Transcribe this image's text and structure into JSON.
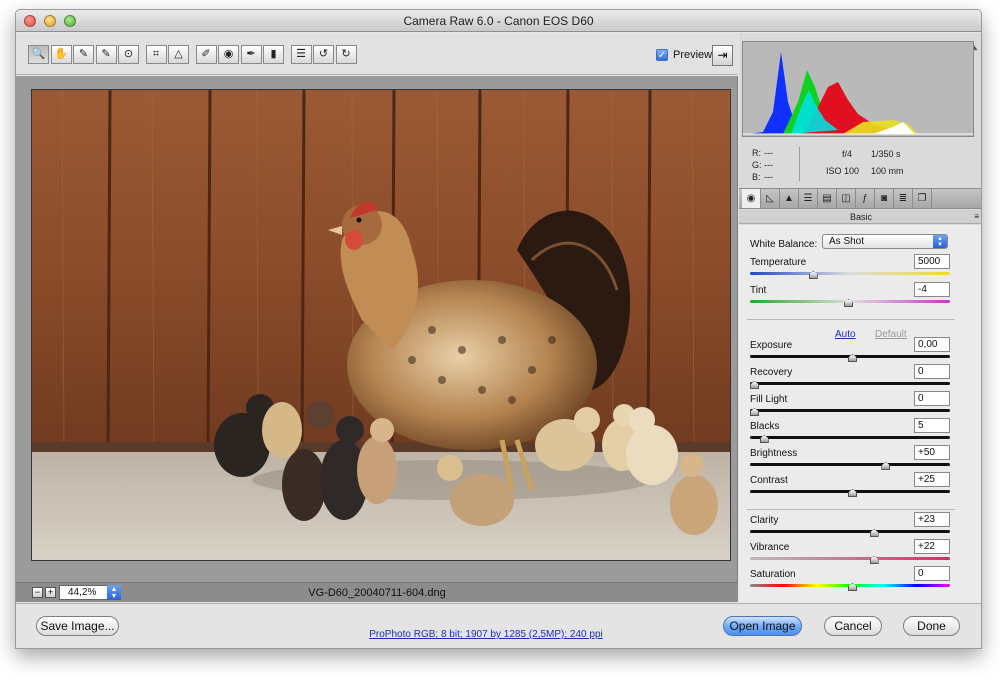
{
  "window": {
    "title": "Camera Raw 6.0  -  Canon EOS D60"
  },
  "toolbar": {
    "tools": [
      {
        "name": "zoom-tool-icon",
        "glyph": "🔍"
      },
      {
        "name": "hand-tool-icon",
        "glyph": "✋"
      },
      {
        "name": "white-balance-tool-icon",
        "glyph": "✎"
      },
      {
        "name": "color-sampler-tool-icon",
        "glyph": "✎"
      },
      {
        "name": "targeted-adjustment-tool-icon",
        "glyph": "⊙"
      },
      {
        "name": "crop-tool-icon",
        "glyph": "⌗"
      },
      {
        "name": "straighten-tool-icon",
        "glyph": "△"
      },
      {
        "name": "spot-removal-tool-icon",
        "glyph": "✐"
      },
      {
        "name": "red-eye-tool-icon",
        "glyph": "◉"
      },
      {
        "name": "adjustment-brush-icon",
        "glyph": "✒"
      },
      {
        "name": "graduated-filter-icon",
        "glyph": "▮"
      },
      {
        "name": "preferences-icon",
        "glyph": "☰"
      },
      {
        "name": "rotate-left-icon",
        "glyph": "↺"
      },
      {
        "name": "rotate-right-icon",
        "glyph": "↻"
      }
    ],
    "preview_label": "Preview"
  },
  "status": {
    "zoom": "44,2%",
    "filename": "VG-D60_20040711-604.dng"
  },
  "footer": {
    "save_label": "Save Image...",
    "workflow_link": "ProPhoto RGB; 8 bit; 1907 by 1285 (2,5MP); 240 ppi",
    "open_label": "Open Image",
    "cancel_label": "Cancel",
    "done_label": "Done"
  },
  "readout": {
    "r_label": "R:",
    "g_label": "G:",
    "b_label": "B:",
    "r": "---",
    "g": "---",
    "b": "---",
    "aperture": "f/4",
    "shutter": "1/350 s",
    "iso": "ISO 100",
    "focal": "100 mm"
  },
  "panel": {
    "title": "Basic",
    "wb_label": "White Balance:",
    "wb_value": "As Shot",
    "auto_label": "Auto",
    "default_label": "Default"
  },
  "sliders": [
    {
      "key": "temperature",
      "label": "Temperature",
      "value": "5000",
      "pos": 0.3
    },
    {
      "key": "tint",
      "label": "Tint",
      "value": "-4",
      "pos": 0.48
    },
    {
      "key": "exposure",
      "label": "Exposure",
      "value": "0,00",
      "pos": 0.5
    },
    {
      "key": "recovery",
      "label": "Recovery",
      "value": "0",
      "pos": 0.0
    },
    {
      "key": "fill-light",
      "label": "Fill Light",
      "value": "0",
      "pos": 0.0
    },
    {
      "key": "blacks",
      "label": "Blacks",
      "value": "5",
      "pos": 0.05
    },
    {
      "key": "brightness",
      "label": "Brightness",
      "value": "+50",
      "pos": 0.67
    },
    {
      "key": "contrast",
      "label": "Contrast",
      "value": "+25",
      "pos": 0.5
    },
    {
      "key": "clarity",
      "label": "Clarity",
      "value": "+23",
      "pos": 0.61
    },
    {
      "key": "vibrance",
      "label": "Vibrance",
      "value": "+22",
      "pos": 0.61
    },
    {
      "key": "saturation",
      "label": "Saturation",
      "value": "0",
      "pos": 0.5
    }
  ],
  "colors": {
    "accent_blue": "#2a62d5",
    "link_blue": "#1a2fb5",
    "barn_wood": "#8a4d2b",
    "histogram_bg": "#b9b9b9"
  }
}
